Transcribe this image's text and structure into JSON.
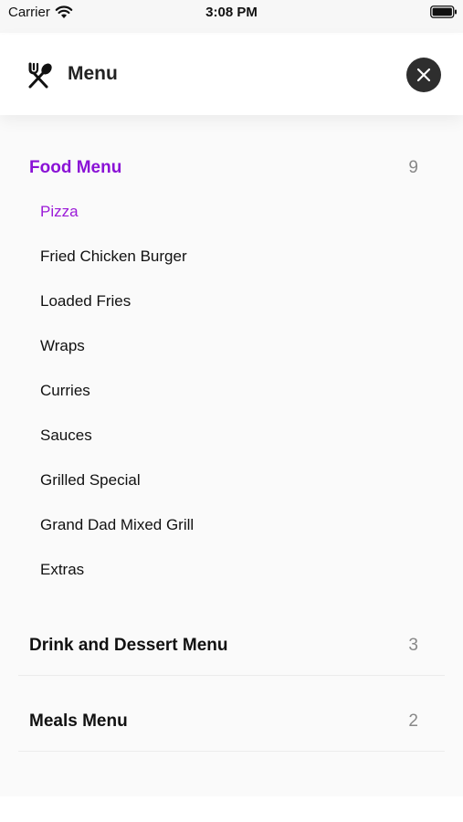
{
  "status_bar": {
    "carrier": "Carrier",
    "time": "3:08 PM"
  },
  "header": {
    "title": "Menu",
    "icon": "cutlery-icon",
    "close_icon": "close-icon"
  },
  "colors": {
    "accent": "#8a12d6",
    "text": "#111111",
    "count": "#888888",
    "background": "#fafafa"
  },
  "sections": [
    {
      "title": "Food Menu",
      "count": "9",
      "expanded": true,
      "items": [
        {
          "label": "Pizza",
          "active": true
        },
        {
          "label": "Fried Chicken Burger",
          "active": false
        },
        {
          "label": "Loaded Fries",
          "active": false
        },
        {
          "label": "Wraps",
          "active": false
        },
        {
          "label": "Curries",
          "active": false
        },
        {
          "label": "Sauces",
          "active": false
        },
        {
          "label": "Grilled Special",
          "active": false
        },
        {
          "label": "Grand Dad Mixed Grill",
          "active": false
        },
        {
          "label": "Extras",
          "active": false
        }
      ]
    },
    {
      "title": "Drink and Dessert Menu",
      "count": "3",
      "expanded": false,
      "items": []
    },
    {
      "title": "Meals Menu",
      "count": "2",
      "expanded": false,
      "items": []
    }
  ]
}
